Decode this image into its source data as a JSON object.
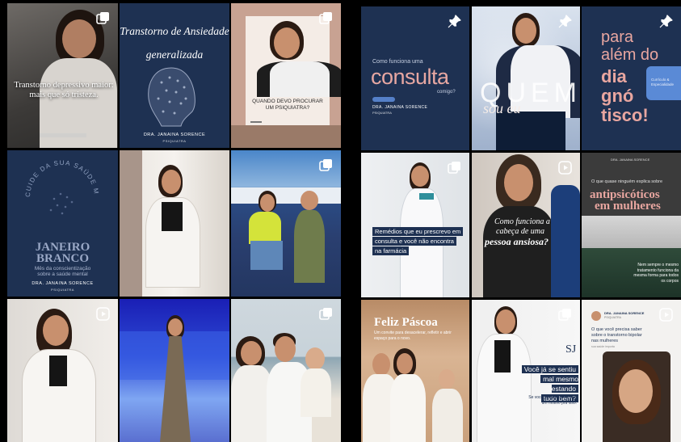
{
  "left_grid": {
    "r1c1": {
      "headline": "Transtorno depressivo maior: mais que só tristeza."
    },
    "r1c2": {
      "title_line1": "Transtorno de Ansiedade",
      "title_line2": "generalizada",
      "signature": "DRA. JANAINA SORENCE",
      "signature_sub": "PSIQUIATRA"
    },
    "r1c3": {
      "question": "QUANDO DEVO PROCURAR UM PSIQUIATRA?"
    },
    "r2c1": {
      "ring_text": "CUIDE DA SUA SAÚDE MENTAL",
      "campaign_line1": "JANEIRO",
      "campaign_line2": "BRANCO",
      "campaign_sub": "Mês da conscientização sobre a saúde mental",
      "signature": "DRA. JANAINA SORENCE",
      "signature_sub": "PSIQUIATRA"
    }
  },
  "right_grid": {
    "r1c1": {
      "intro": "Como funciona uma",
      "big": "consulta",
      "outro": "comigo?",
      "signature": "DRA. JANAINA SORENCE",
      "signature_sub": "PSIQUIATRA"
    },
    "r1c2": {
      "big": "QUEM",
      "sub": "sou eu"
    },
    "r1c3": {
      "line1": "para",
      "line2": "além do",
      "line3": "dia",
      "line4": "gnó",
      "line5": "tisco!",
      "badge": "Currículo & Especialidade"
    },
    "r2c1": {
      "text": "Remédios que eu prescrevo em consulta e você não encontra na farmácia"
    },
    "r2c2": {
      "line1": "Como funciona a",
      "line2": "cabeça de uma",
      "line3": "pessoa ansiosa?"
    },
    "r2c3": {
      "signature": "DRA. JANAINA SORENCE",
      "intro": "O que quase ninguém explica sobre",
      "big1": "antipsicóticos",
      "big2": "em mulheres",
      "body": "Nem sempre o mesmo tratamento funciona da mesma forma para todos os corpos"
    },
    "r3c1": {
      "title": "Feliz Páscoa",
      "sub": "Um convite para desacelerar, refletir e abrir espaço para o novo."
    },
    "r3c2": {
      "monogram": "SJ",
      "line1": "Você já se sentiu",
      "line2": "mal mesmo estando",
      "line3": "tudo bem?",
      "foot": "Se você se identificou, tem um motivo pra isso."
    },
    "r3c3": {
      "author": "DRA. JANAINA SORENCE",
      "author_sub": "PSIQUIATRA",
      "line1": "O que você precisa saber",
      "line2": "sobre o transtorno bipolar",
      "line3": "nas mulheres",
      "foot": "sua saúde importa"
    }
  },
  "icons": {
    "carousel": "carousel-icon",
    "pin": "pin-icon",
    "reel": "reel-icon"
  },
  "colors": {
    "navy": "#1e3152",
    "rose": "#e8a6a0",
    "dark": "#000000"
  }
}
